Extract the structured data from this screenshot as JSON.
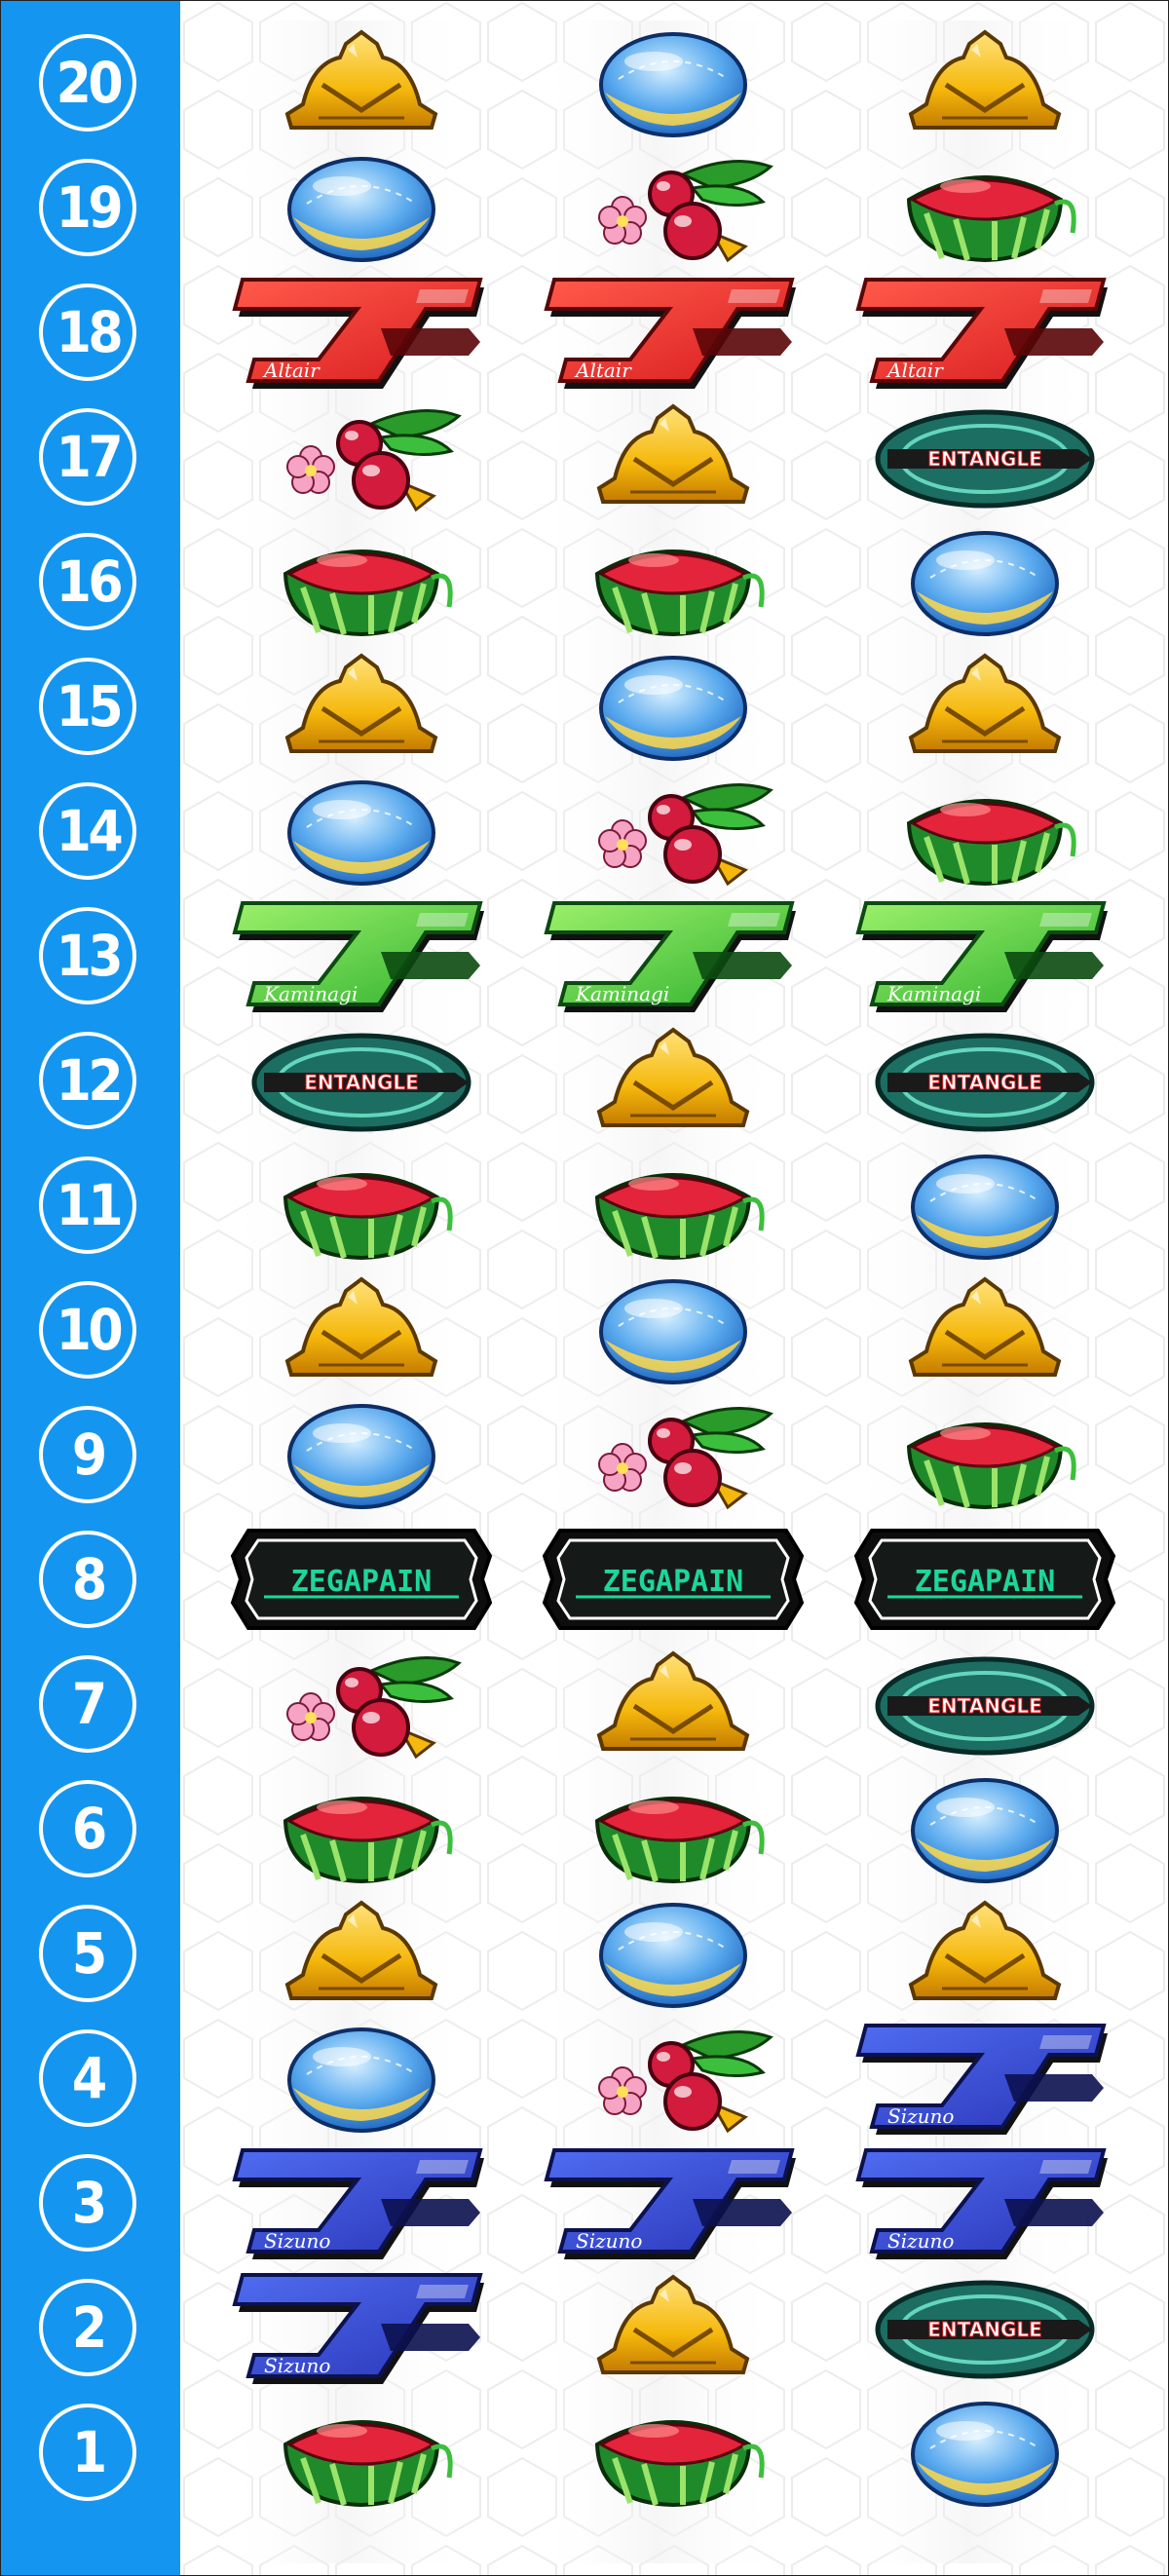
{
  "reel_strip": {
    "rows": [
      {
        "number": "20",
        "reels": [
          "bell",
          "replay",
          "bell"
        ]
      },
      {
        "number": "19",
        "reels": [
          "replay",
          "cherry",
          "watermelon"
        ]
      },
      {
        "number": "18",
        "reels": [
          "red-seven",
          "red-seven",
          "red-seven"
        ]
      },
      {
        "number": "17",
        "reels": [
          "cherry",
          "bell",
          "entangle"
        ]
      },
      {
        "number": "16",
        "reels": [
          "watermelon",
          "watermelon",
          "replay"
        ]
      },
      {
        "number": "15",
        "reels": [
          "bell",
          "replay",
          "bell"
        ]
      },
      {
        "number": "14",
        "reels": [
          "replay",
          "cherry",
          "watermelon"
        ]
      },
      {
        "number": "13",
        "reels": [
          "green-seven",
          "green-seven",
          "green-seven"
        ]
      },
      {
        "number": "12",
        "reels": [
          "entangle",
          "bell",
          "entangle"
        ]
      },
      {
        "number": "11",
        "reels": [
          "watermelon",
          "watermelon",
          "replay"
        ]
      },
      {
        "number": "10",
        "reels": [
          "bell",
          "replay",
          "bell"
        ]
      },
      {
        "number": "9",
        "reels": [
          "replay",
          "cherry",
          "watermelon"
        ]
      },
      {
        "number": "8",
        "reels": [
          "zegapain",
          "zegapain",
          "zegapain"
        ]
      },
      {
        "number": "7",
        "reels": [
          "cherry",
          "bell",
          "entangle"
        ]
      },
      {
        "number": "6",
        "reels": [
          "watermelon",
          "watermelon",
          "replay"
        ]
      },
      {
        "number": "5",
        "reels": [
          "bell",
          "replay",
          "bell"
        ]
      },
      {
        "number": "4",
        "reels": [
          "replay",
          "cherry",
          "blue-seven"
        ]
      },
      {
        "number": "3",
        "reels": [
          "blue-seven",
          "blue-seven",
          "blue-seven"
        ]
      },
      {
        "number": "2",
        "reels": [
          "blue-seven",
          "bell",
          "entangle"
        ]
      },
      {
        "number": "1",
        "reels": [
          "watermelon",
          "watermelon",
          "replay"
        ]
      }
    ]
  },
  "symbols": {
    "red-seven": {
      "label": "Altair",
      "color": "#d81c20"
    },
    "green-seven": {
      "label": "Kaminagi",
      "color": "#2fb12f"
    },
    "blue-seven": {
      "label": "Sizuno",
      "color": "#2a35b8"
    },
    "zegapain": {
      "label": "ZEGAPAIN",
      "color": "#1ed69a"
    },
    "entangle": {
      "label": "ENTANGLE",
      "color": "#2aa08a"
    },
    "bell": {
      "color": "#f5b80c"
    },
    "replay": {
      "color": "#4aa3e8"
    },
    "cherry": {
      "color": "#d31b3d"
    },
    "watermelon": {
      "color": "#2a9a2a"
    }
  },
  "colors": {
    "number_column": "#1496f0",
    "badge_text": "#ffffff"
  }
}
